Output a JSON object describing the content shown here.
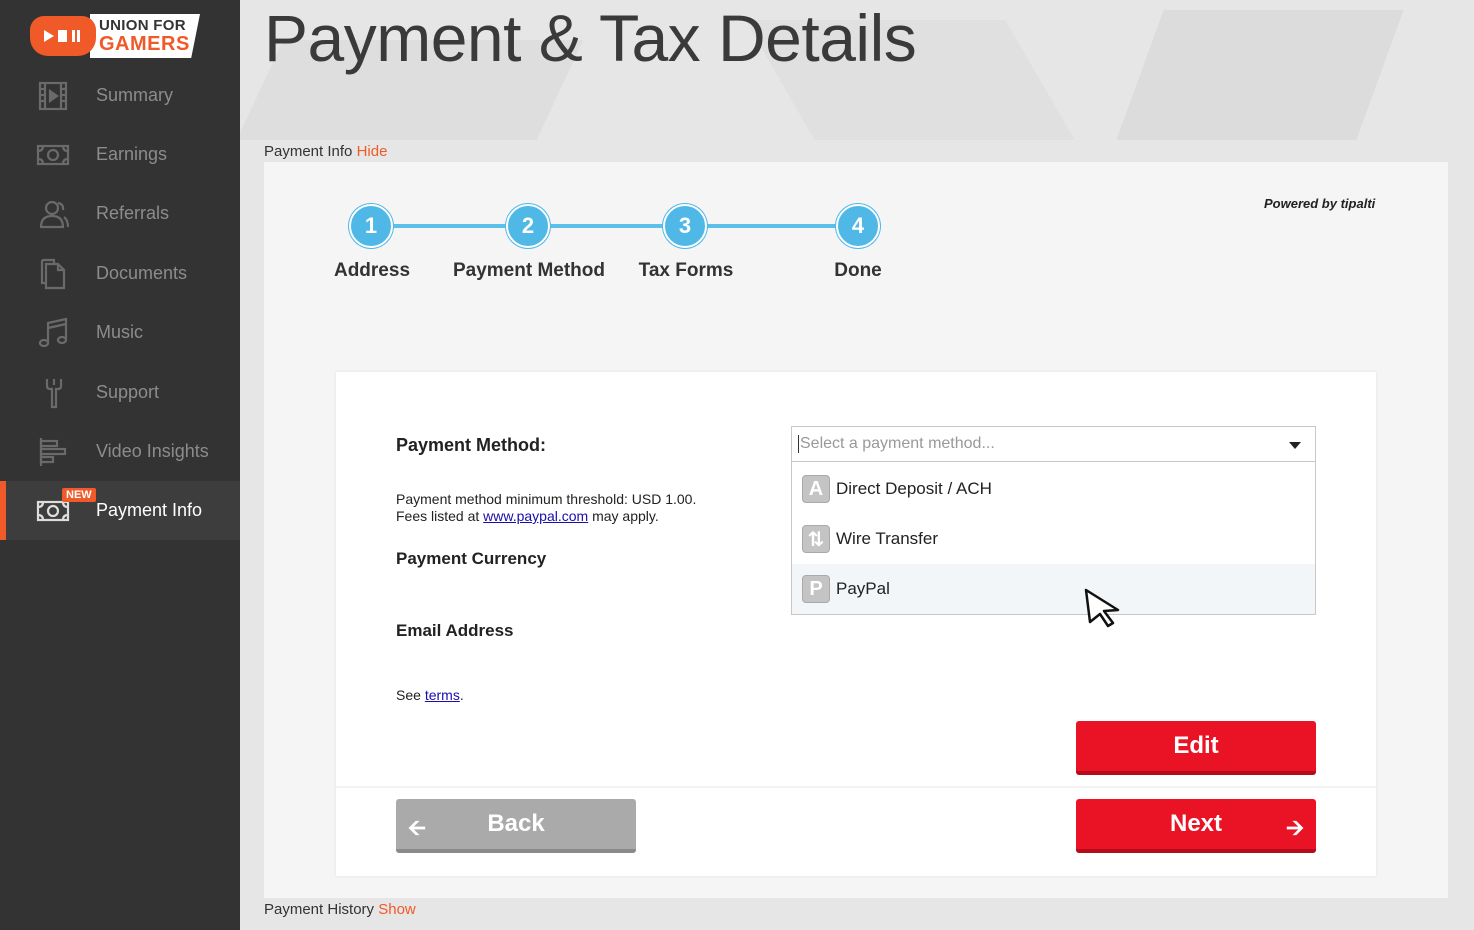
{
  "brand": {
    "line1": "UNION FOR",
    "line2": "GAMERS"
  },
  "sidebar": {
    "items": [
      {
        "label": "Summary",
        "icon": "film-icon"
      },
      {
        "label": "Earnings",
        "icon": "money-icon"
      },
      {
        "label": "Referrals",
        "icon": "users-icon"
      },
      {
        "label": "Documents",
        "icon": "documents-icon"
      },
      {
        "label": "Music",
        "icon": "music-note-icon"
      },
      {
        "label": "Support",
        "icon": "wrench-icon"
      },
      {
        "label": "Video Insights",
        "icon": "bar-chart-icon"
      },
      {
        "label": "Payment Info",
        "icon": "money-icon",
        "badge": "NEW",
        "active": true
      }
    ]
  },
  "page": {
    "title": "Payment & Tax Details",
    "payment_info_label": "Payment Info",
    "payment_info_toggle": "Hide",
    "payment_history_label": "Payment History",
    "payment_history_toggle": "Show"
  },
  "widget": {
    "powered_by": "Powered by",
    "powered_brand": "tipalti",
    "steps": [
      {
        "number": "1",
        "label": "Address"
      },
      {
        "number": "2",
        "label": "Payment Method"
      },
      {
        "number": "3",
        "label": "Tax Forms"
      },
      {
        "number": "4",
        "label": "Done"
      }
    ]
  },
  "form": {
    "payment_method_label": "Payment Method:",
    "threshold_text": "Payment method minimum threshold: USD 1.00.",
    "fees_prefix": "Fees listed at",
    "fees_link": "www.paypal.com",
    "fees_suffix": "may apply.",
    "currency_label": "Payment Currency",
    "email_label": "Email Address",
    "see_prefix": "See",
    "terms_link": "terms",
    "see_suffix": ".",
    "select_placeholder": "Select a payment method...",
    "options": [
      {
        "label": "Direct Deposit / ACH",
        "icon_letter": "A"
      },
      {
        "label": "Wire Transfer",
        "icon_letter": "⇅"
      },
      {
        "label": "PayPal",
        "icon_letter": "P"
      }
    ],
    "edit_button": "Edit",
    "back_button": "Back",
    "next_button": "Next"
  },
  "colors": {
    "accent": "#f05a28",
    "step_blue": "#4fb8e7",
    "button_red": "#ea1326",
    "button_grey": "#aaaaaa"
  }
}
